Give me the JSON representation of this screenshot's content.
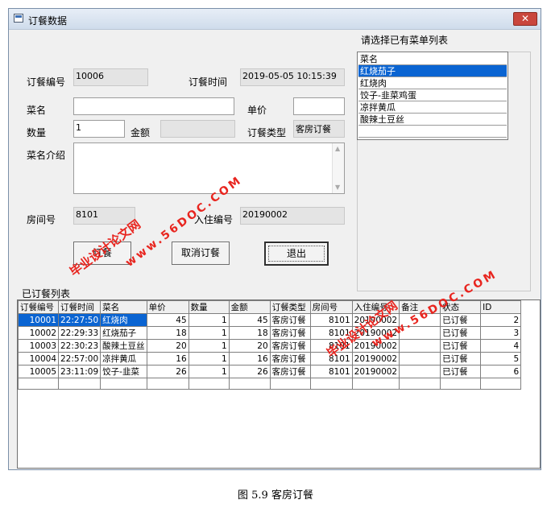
{
  "window": {
    "title": "订餐数据",
    "close_glyph": "✕"
  },
  "form": {
    "order_no_label": "订餐编号",
    "order_no_value": "10006",
    "order_time_label": "订餐时间",
    "order_time_value": "2019-05-05 10:15:39",
    "dish_label": "菜名",
    "dish_value": "",
    "price_label": "单价",
    "price_value": "",
    "qty_label": "数量",
    "qty_value": "1",
    "amount_label": "金额",
    "amount_value": "",
    "order_type_label": "订餐类型",
    "order_type_value": "客房订餐",
    "intro_label": "菜名介绍",
    "intro_value": "",
    "room_label": "房间号",
    "room_value": "8101",
    "checkin_label": "入住编号",
    "checkin_value": "20190002"
  },
  "buttons": {
    "order_label": "订餐",
    "cancel_label": "取消订餐",
    "exit_label": "退出"
  },
  "menu_list": {
    "heading": "请选择已有菜单列表",
    "header": "菜名",
    "items": [
      "红烧茄子",
      "红烧肉",
      "饺子-韭菜鸡蛋",
      "凉拌黄瓜",
      "酸辣土豆丝"
    ],
    "selected_index": 0
  },
  "orders": {
    "heading": "已订餐列表",
    "columns": [
      "订餐编号",
      "订餐时间",
      "菜名",
      "单价",
      "数量",
      "金额",
      "订餐类型",
      "房间号",
      "入住编号",
      "备注",
      "状态",
      "ID"
    ],
    "rows": [
      [
        "10001",
        "22:27:50",
        "红烧肉",
        "45",
        "1",
        "45",
        "客房订餐",
        "8101",
        "20190002",
        "",
        "已订餐",
        "2"
      ],
      [
        "10002",
        "22:29:33",
        "红烧茄子",
        "18",
        "1",
        "18",
        "客房订餐",
        "8101",
        "20190002",
        "",
        "已订餐",
        "3"
      ],
      [
        "10003",
        "22:30:23",
        "酸辣土豆丝",
        "20",
        "1",
        "20",
        "客房订餐",
        "8101",
        "20190002",
        "",
        "已订餐",
        "4"
      ],
      [
        "10004",
        "22:57:00",
        "凉拌黄瓜",
        "16",
        "1",
        "16",
        "客房订餐",
        "8101",
        "20190002",
        "",
        "已订餐",
        "5"
      ],
      [
        "10005",
        "23:11:09",
        "饺子-韭菜",
        "26",
        "1",
        "26",
        "客房订餐",
        "8101",
        "20190002",
        "",
        "已订餐",
        "6"
      ]
    ]
  },
  "watermarks": {
    "cn_text": "毕业设计论文网",
    "url_text": "www.56DOC.COM",
    "color": "#e8251f"
  },
  "figure_caption": "图 5.9 客房订餐",
  "colors": {
    "selection": "#0a64d2",
    "close_button": "#c9463d"
  }
}
